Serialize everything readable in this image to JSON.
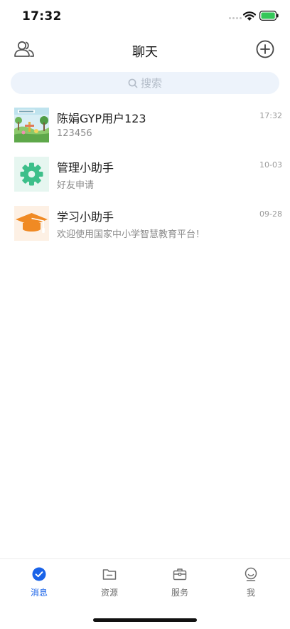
{
  "status_bar": {
    "time": "17:32"
  },
  "header": {
    "title": "聊天"
  },
  "search": {
    "placeholder": "搜索"
  },
  "chats": [
    {
      "name": "陈娟GYP用户123",
      "preview": "123456",
      "time": "17:32",
      "avatar": "landscape-thumbnail"
    },
    {
      "name": "管理小助手",
      "preview": "好友申请",
      "time": "10-03",
      "avatar": "gear-icon"
    },
    {
      "name": "学习小助手",
      "preview": "欢迎使用国家中小学智慧教育平台！",
      "time": "09-28",
      "avatar": "graduation-cap-icon"
    }
  ],
  "tabs": [
    {
      "label": "消息",
      "active": true
    },
    {
      "label": "资源",
      "active": false
    },
    {
      "label": "服务",
      "active": false
    },
    {
      "label": "我",
      "active": false
    }
  ],
  "colors": {
    "accent": "#1a63e8",
    "battery": "#34c759",
    "gear_green": "#3dbf8a",
    "cap_orange": "#f08a24"
  }
}
